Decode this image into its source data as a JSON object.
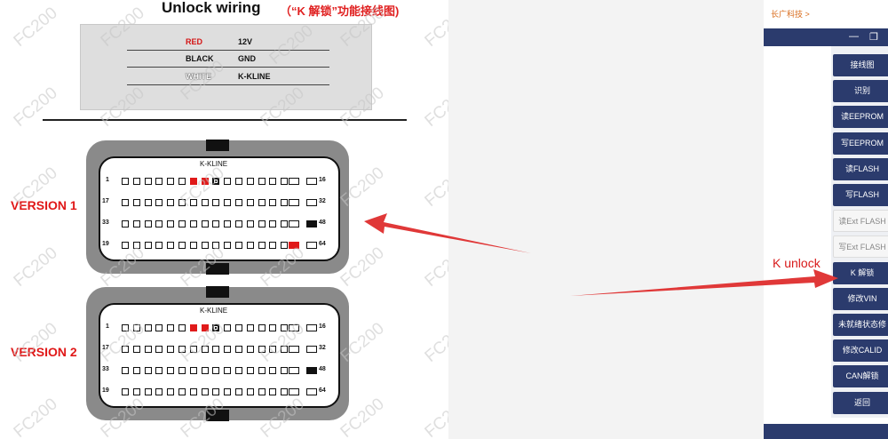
{
  "document": {
    "title": "Unlock wiring",
    "subtitle": "（“K 解锁”功能接线图)",
    "legend": [
      {
        "color_name": "RED",
        "signal": "12V",
        "color": "#d41414"
      },
      {
        "color_name": "BLACK",
        "signal": "GND",
        "color": "#111111"
      },
      {
        "color_name": "WHITE",
        "signal": "K-KLINE",
        "color": "#ffffff"
      }
    ],
    "watermark": "FC200",
    "versions": [
      {
        "label": "VERSION 1",
        "kline_label": "K-KLINE",
        "row_numbers": [
          [
            "1",
            "16"
          ],
          [
            "17",
            "32"
          ],
          [
            "33",
            "48"
          ],
          [
            "19",
            "64"
          ]
        ]
      },
      {
        "label": "VERSION 2",
        "kline_label": "K-KLINE",
        "row_numbers": [
          [
            "1",
            "16"
          ],
          [
            "17",
            "32"
          ],
          [
            "33",
            "48"
          ],
          [
            "19",
            "64"
          ]
        ]
      }
    ]
  },
  "annotation": {
    "k_unlock_label": "K unlock"
  },
  "app": {
    "breadcrumb": "长广科技 >",
    "window_controls": [
      "minimize-icon",
      "restore-icon"
    ],
    "buttons": [
      {
        "label": "接线图",
        "enabled": true
      },
      {
        "label": "识别",
        "enabled": true
      },
      {
        "label": "读EEPROM",
        "enabled": true
      },
      {
        "label": "写EEPROM",
        "enabled": true
      },
      {
        "label": "读FLASH",
        "enabled": true
      },
      {
        "label": "写FLASH",
        "enabled": true
      },
      {
        "label": "读Ext FLASH",
        "enabled": false
      },
      {
        "label": "写Ext FLASH",
        "enabled": false
      },
      {
        "label": "K 解锁",
        "enabled": true
      },
      {
        "label": "修改VIN",
        "enabled": true
      },
      {
        "label": "未就绪状态修",
        "enabled": true
      },
      {
        "label": "修改CALID",
        "enabled": true
      },
      {
        "label": "CAN解锁",
        "enabled": true
      },
      {
        "label": "返回",
        "enabled": true
      }
    ],
    "colors": {
      "primary": "#2b3b6d",
      "accent": "#d81a1a"
    }
  }
}
